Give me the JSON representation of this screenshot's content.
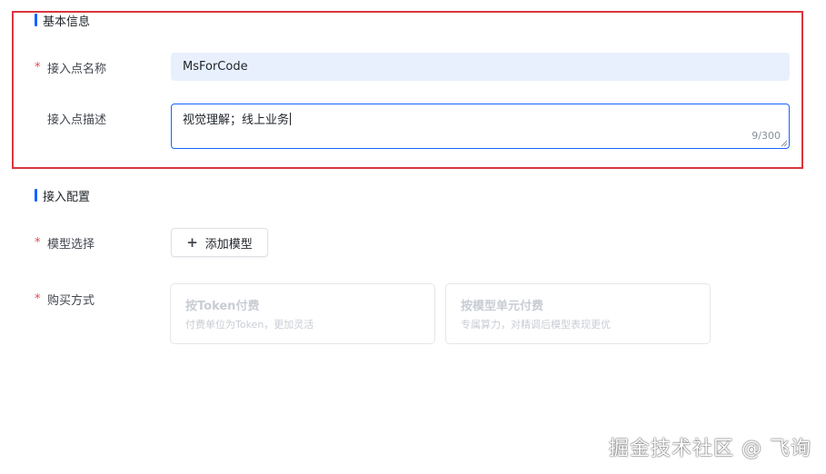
{
  "basic_info": {
    "section_title": "基本信息",
    "name_label": "接入点名称",
    "name_value": "MsForCode",
    "desc_label": "接入点描述",
    "desc_value": "视觉理解；线上业务",
    "desc_count": "9/300",
    "required_mark": "*"
  },
  "access_config": {
    "section_title": "接入配置",
    "model_label": "模型选择",
    "add_model_button": "添加模型",
    "purchase_label": "购买方式",
    "purchase_options": [
      {
        "title": "按Token付费",
        "desc": "付费单位为Token，更加灵活"
      },
      {
        "title": "按模型单元付费",
        "desc": "专属算力，对精调后模型表现更优"
      }
    ]
  },
  "watermark": "掘金技术社区 @ 飞询",
  "colors": {
    "accent": "#1664ff",
    "required": "#e5484d",
    "highlight_border": "#d9363e",
    "input_filled_bg": "#e8f0fe",
    "disabled_text": "#c9cdd4"
  }
}
